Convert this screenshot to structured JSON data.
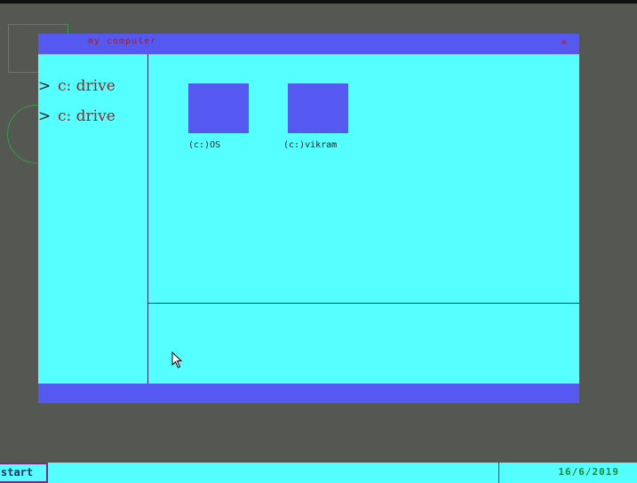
{
  "window": {
    "title": "my computer",
    "close_glyph": "×"
  },
  "sidebar": {
    "items": [
      {
        "arrow": ">",
        "label": "c: drive"
      },
      {
        "arrow": ">",
        "label": "c: drive"
      }
    ]
  },
  "main": {
    "drives": [
      {
        "label": "(c:)OS",
        "icon": "drive-icon"
      },
      {
        "label": "(c:)vikram",
        "icon": "drive-icon"
      }
    ]
  },
  "taskbar": {
    "start_label": "start",
    "date": "16/6/2019"
  },
  "colors": {
    "desktop": "#555752",
    "window_bg": "#55ffff",
    "titlebar": "#5559f2",
    "accent_red": "#a82020",
    "clock_green": "#1f8a2a"
  }
}
